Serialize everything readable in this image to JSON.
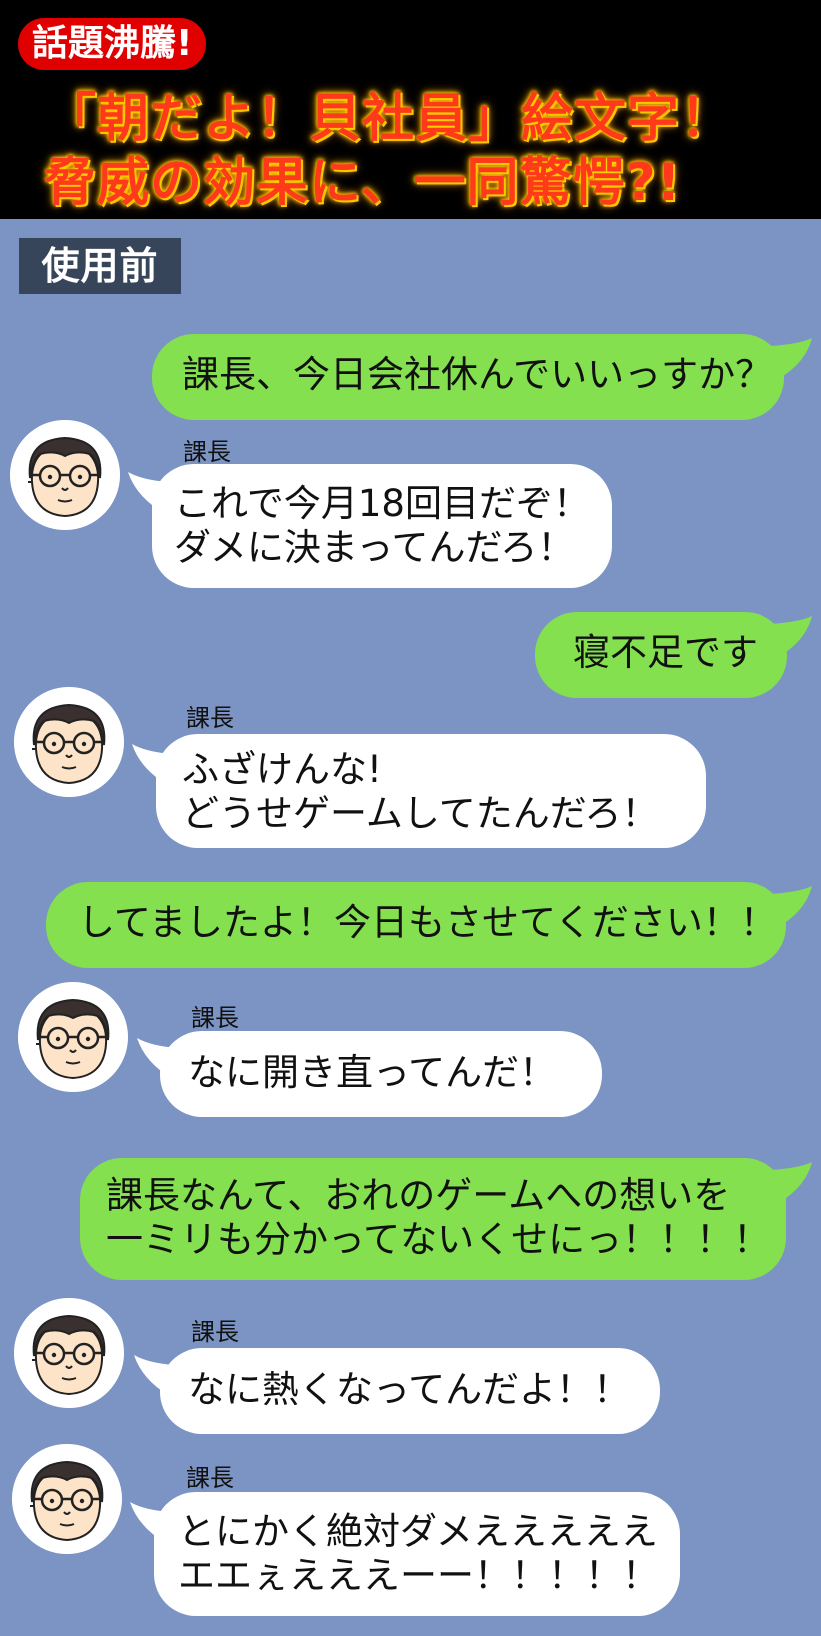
{
  "header": {
    "badge": "話題沸騰!",
    "headline_line1": "「朝だよ！貝社員」絵文字！",
    "headline_line2": "脅威の効果に、一同驚愕?!"
  },
  "section_label": "使用前",
  "colors": {
    "background": "#7b94c4",
    "green_bubble": "#84e04f",
    "white_bubble": "#ffffff",
    "badge": "#e00000",
    "headline": "#ff3a1a",
    "section_label_bg": "#37455a"
  },
  "messages": [
    {
      "side": "right",
      "lines": [
        "課長、今日会社休んでいいっすか？"
      ]
    },
    {
      "side": "left",
      "sender": "課長",
      "avatar": "manager-avatar",
      "lines": [
        "これで今月18回目だぞ！",
        "ダメに決まってんだろ！"
      ]
    },
    {
      "side": "right",
      "lines": [
        "寝不足です"
      ]
    },
    {
      "side": "left",
      "sender": "課長",
      "avatar": "manager-avatar",
      "lines": [
        "ふざけんな!",
        "どうせゲームしてたんだろ！"
      ]
    },
    {
      "side": "right",
      "lines": [
        "してましたよ！今日もさせてください！！"
      ]
    },
    {
      "side": "left",
      "sender": "課長",
      "avatar": "manager-avatar",
      "lines": [
        "なに開き直ってんだ！"
      ]
    },
    {
      "side": "right",
      "lines": [
        "課長なんて、おれのゲームへの想いを",
        "一ミリも分かってないくせにっ！！！！"
      ]
    },
    {
      "side": "left",
      "sender": "課長",
      "avatar": "manager-avatar",
      "lines": [
        "なに熱くなってんだよ！！"
      ]
    },
    {
      "side": "left",
      "sender": "課長",
      "avatar": "manager-avatar",
      "lines": [
        "とにかく絶対ダメえええええ",
        "エエぇえええーー！！！！！"
      ]
    }
  ]
}
